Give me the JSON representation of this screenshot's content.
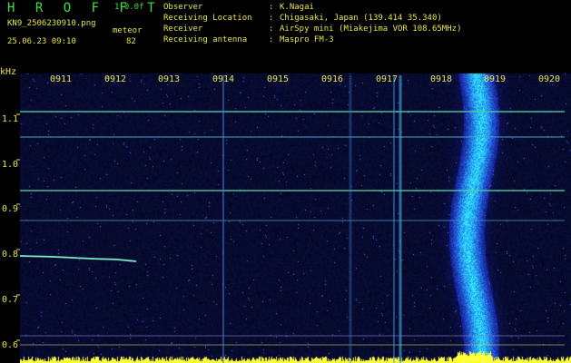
{
  "header": {
    "app_title": "H R O F F T",
    "version": "1.0.0f",
    "filename": "KN9_2506230910.png",
    "meteor_label": "meteor",
    "timestamp": "25.06.23 09:10",
    "meteor_count": "82"
  },
  "meta": [
    {
      "key": "Observer",
      "sep": ":",
      "value": "K.Nagai"
    },
    {
      "key": "Receiving Location",
      "sep": ":",
      "value": "Chigasaki, Japan (139.414 35.340)"
    },
    {
      "key": "Receiver",
      "sep": ":",
      "value": "AirSpy mini (Miakejima VOR 108.65MHz)"
    },
    {
      "key": "Receiving antenna",
      "sep": ":",
      "value": "Maspro FM-3"
    }
  ],
  "spectrogram": {
    "y_unit": "kHz",
    "y_labels": [
      "1.1",
      "1.0",
      "0.9",
      "0.8",
      "0.7",
      "0.6"
    ],
    "x_labels": [
      "0911",
      "0912",
      "0913",
      "0914",
      "0915",
      "0916",
      "0917",
      "0918",
      "0919",
      "0920"
    ],
    "colors": {
      "background": "#11166f",
      "text": "#e6e64a",
      "title": "#3fe03f",
      "signal": "#3ad7d0",
      "hot": "#ffff3a"
    }
  }
}
